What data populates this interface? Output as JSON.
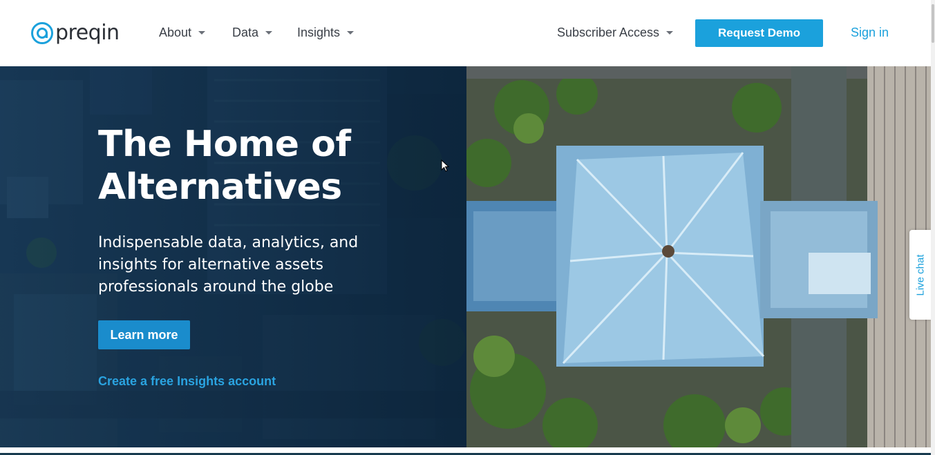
{
  "brand": {
    "name": "preqin",
    "logo_icon": "at-sign-logo-icon",
    "accent_color": "#1ba1dc"
  },
  "nav": {
    "items": [
      {
        "label": "About"
      },
      {
        "label": "Data"
      },
      {
        "label": "Insights"
      }
    ],
    "subscriber_access": "Subscriber Access",
    "request_demo": "Request Demo",
    "sign_in": "Sign in"
  },
  "hero": {
    "title_line1": "The Home of",
    "title_line2": "Alternatives",
    "subtitle": "Indispensable data, analytics, and insights for alternative assets professionals around the globe",
    "cta_label": "Learn more",
    "secondary_link": "Create a free Insights account"
  },
  "widgets": {
    "live_chat": "Live chat"
  }
}
